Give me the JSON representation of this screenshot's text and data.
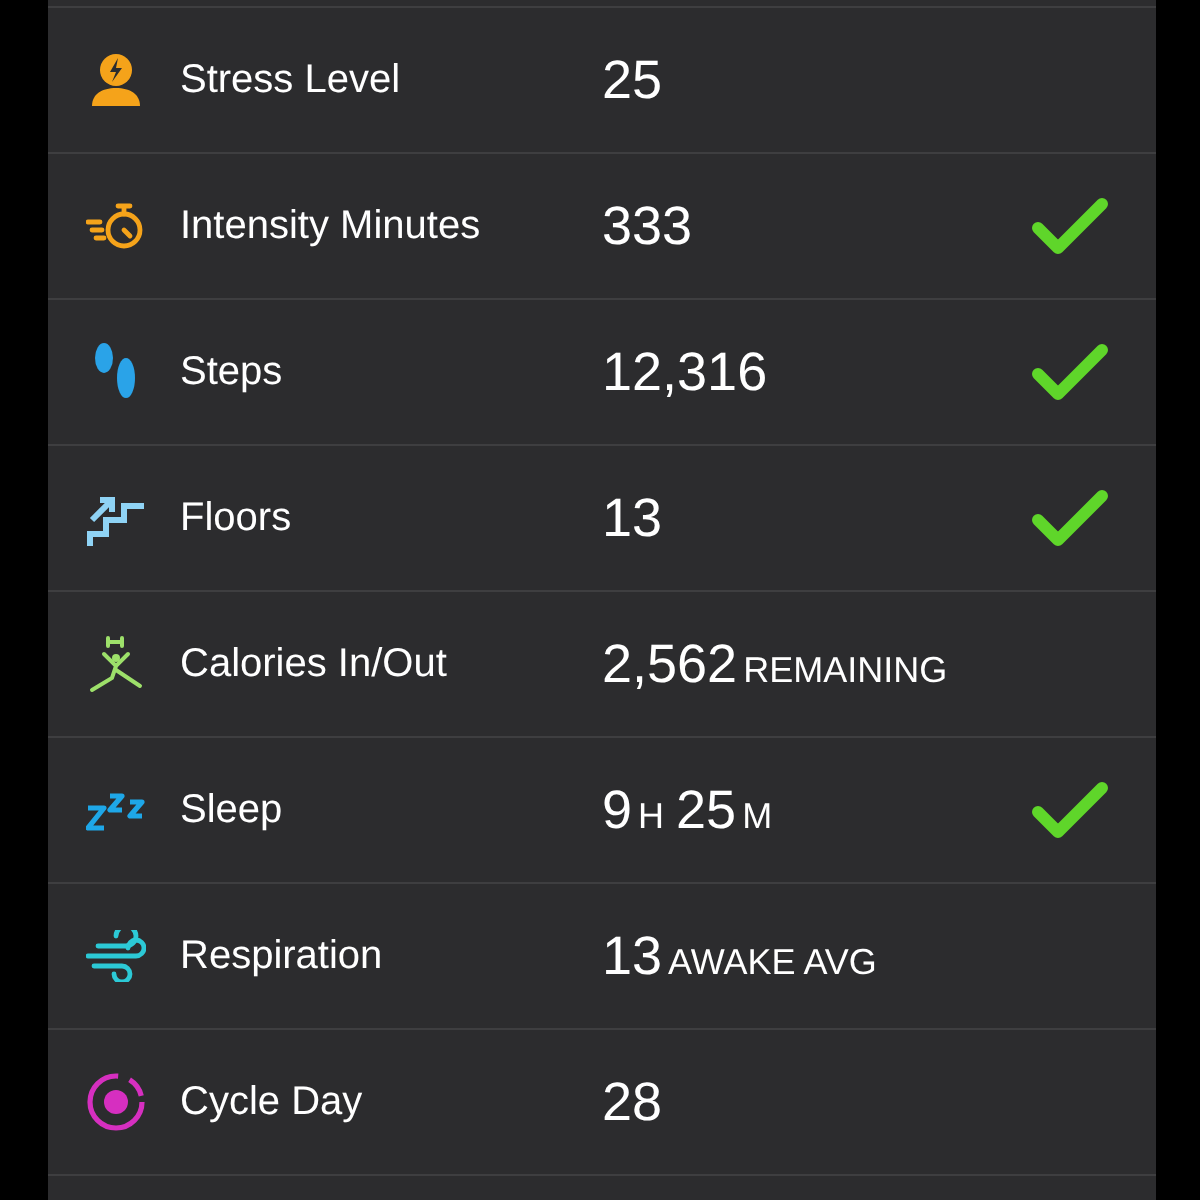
{
  "metrics": [
    {
      "kind": "stress",
      "label": "Stress Level",
      "value": [
        {
          "kind": "number",
          "text": "25"
        }
      ],
      "achieved": false
    },
    {
      "kind": "intensity",
      "label": "Intensity Minutes",
      "value": [
        {
          "kind": "number",
          "text": "333"
        }
      ],
      "achieved": true
    },
    {
      "kind": "steps",
      "label": "Steps",
      "value": [
        {
          "kind": "number",
          "text": "12,316"
        }
      ],
      "achieved": true
    },
    {
      "kind": "floors",
      "label": "Floors",
      "value": [
        {
          "kind": "number",
          "text": "13"
        }
      ],
      "achieved": true
    },
    {
      "kind": "calories",
      "label": "Calories In/Out",
      "value": [
        {
          "kind": "number",
          "text": "2,562"
        },
        {
          "kind": "unit",
          "text": "REMAINING"
        }
      ],
      "achieved": false
    },
    {
      "kind": "sleep",
      "label": "Sleep",
      "value": [
        {
          "kind": "number",
          "text": "9"
        },
        {
          "kind": "unit",
          "text": "H"
        },
        {
          "kind": "number",
          "text": "25"
        },
        {
          "kind": "unit",
          "text": "M"
        }
      ],
      "achieved": true
    },
    {
      "kind": "respiration",
      "label": "Respiration",
      "value": [
        {
          "kind": "number",
          "text": "13"
        },
        {
          "kind": "unit",
          "text": "AWAKE AVG"
        }
      ],
      "achieved": false
    },
    {
      "kind": "cycle",
      "label": "Cycle Day",
      "value": [
        {
          "kind": "number",
          "text": "28"
        }
      ],
      "achieved": false
    }
  ]
}
